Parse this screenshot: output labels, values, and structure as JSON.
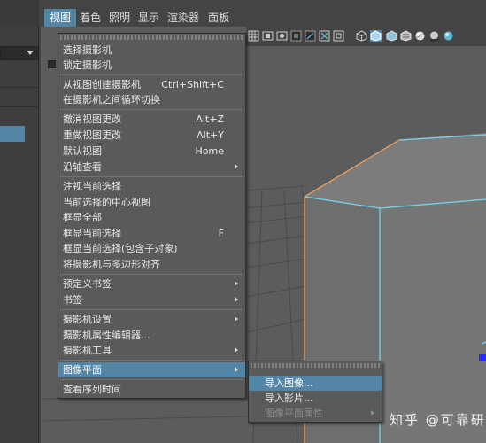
{
  "menubar": {
    "items": [
      {
        "label": "视图",
        "active": true
      },
      {
        "label": "着色",
        "active": false
      },
      {
        "label": "照明",
        "active": false
      },
      {
        "label": "显示",
        "active": false
      },
      {
        "label": "渲染器",
        "active": false
      },
      {
        "label": "面板",
        "active": false
      }
    ]
  },
  "toolbar": {
    "icons": [
      "grid-icon",
      "film-gate-icon",
      "resolution-gate-icon",
      "safe-action-icon",
      "camera-lock-icon",
      "isolate-select-icon",
      "frame-icon",
      "wireframe-cube-icon",
      "smooth-shade-cube-icon",
      "shaded-wireframe-icon",
      "textured-icon",
      "lighting-icon",
      "shadows-icon",
      "ambient-occlusion-icon"
    ]
  },
  "view_menu": {
    "items": [
      {
        "label": "选择摄影机",
        "shortcut": ""
      },
      {
        "label": "锁定摄影机",
        "shortcut": ""
      },
      {
        "label": "从视图创建摄影机",
        "shortcut": "Ctrl+Shift+C"
      },
      {
        "label": "在摄影机之间循环切换",
        "shortcut": ""
      },
      {
        "label": "撤消视图更改",
        "shortcut": "Alt+Z"
      },
      {
        "label": "重做视图更改",
        "shortcut": "Alt+Y"
      },
      {
        "label": "默认视图",
        "shortcut": "Home"
      },
      {
        "label": "沿轴查看",
        "shortcut": ""
      },
      {
        "label": "注视当前选择",
        "shortcut": ""
      },
      {
        "label": "当前选择的中心视图",
        "shortcut": ""
      },
      {
        "label": "框显全部",
        "shortcut": ""
      },
      {
        "label": "框显当前选择",
        "shortcut": "F"
      },
      {
        "label": "框显当前选择(包含子对象)",
        "shortcut": ""
      },
      {
        "label": "将摄影机与多边形对齐",
        "shortcut": ""
      },
      {
        "label": "预定义书签",
        "shortcut": ""
      },
      {
        "label": "书签",
        "shortcut": ""
      },
      {
        "label": "摄影机设置",
        "shortcut": ""
      },
      {
        "label": "摄影机属性编辑器...",
        "shortcut": ""
      },
      {
        "label": "摄影机工具",
        "shortcut": ""
      },
      {
        "label": "图像平面",
        "shortcut": ""
      },
      {
        "label": "查看序列时间",
        "shortcut": ""
      }
    ]
  },
  "image_plane_menu": {
    "items": [
      {
        "label": "导入图像...",
        "enabled": true
      },
      {
        "label": "导入影片...",
        "enabled": true
      },
      {
        "label": "图像平面属性",
        "enabled": false
      }
    ]
  },
  "watermark": "知乎 @可靠研究",
  "colors": {
    "menu_bg": "#5a5a5a",
    "highlight": "#5285a6",
    "viewport_bg": "#5c5c5c",
    "selection_edge": "#6fd3ee",
    "active_edge": "#f0a060"
  }
}
